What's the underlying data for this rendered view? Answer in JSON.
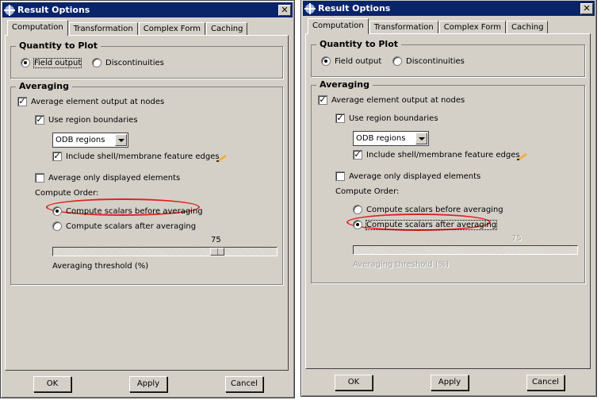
{
  "dialogs": [
    {
      "title": "Result Options",
      "tabs": [
        "Computation",
        "Transformation",
        "Complex Form",
        "Caching"
      ],
      "active_tab": "Computation",
      "quantity": {
        "title": "Quantity to Plot",
        "options": [
          "Field output",
          "Discontinuities"
        ],
        "selected": "Field output"
      },
      "averaging": {
        "title": "Averaging",
        "avg_nodes_label": "Average element output at nodes",
        "avg_nodes_checked": true,
        "region_label": "Use region boundaries",
        "region_checked": true,
        "region_combo": "ODB regions",
        "shell_label": "Include shell/membrane feature edges",
        "shell_checked": true,
        "displayed_label": "Average only displayed elements",
        "displayed_checked": false,
        "compute_order_label": "Compute Order:",
        "order_options": [
          "Compute scalars before averaging",
          "Compute scalars after averaging"
        ],
        "order_selected": "Compute scalars before averaging",
        "threshold_value": "75",
        "threshold_label": "Averaging threshold (%)",
        "threshold_enabled": true
      },
      "buttons": [
        "OK",
        "Apply",
        "Cancel"
      ]
    },
    {
      "title": "Result Options",
      "tabs": [
        "Computation",
        "Transformation",
        "Complex Form",
        "Caching"
      ],
      "active_tab": "Computation",
      "quantity": {
        "title": "Quantity to Plot",
        "options": [
          "Field output",
          "Discontinuities"
        ],
        "selected": "Field output"
      },
      "averaging": {
        "title": "Averaging",
        "avg_nodes_label": "Average element output at nodes",
        "avg_nodes_checked": true,
        "region_label": "Use region boundaries",
        "region_checked": true,
        "region_combo": "ODB regions",
        "shell_label": "Include shell/membrane feature edges",
        "shell_checked": true,
        "displayed_label": "Average only displayed elements",
        "displayed_checked": false,
        "compute_order_label": "Compute Order:",
        "order_options": [
          "Compute scalars before averaging",
          "Compute scalars after averaging"
        ],
        "order_selected": "Compute scalars after averaging",
        "threshold_value": "75",
        "threshold_label": "Averaging threshold (%)",
        "threshold_enabled": false
      },
      "buttons": [
        "OK",
        "Apply",
        "Cancel"
      ]
    }
  ],
  "annotation_color": "#e02020",
  "threshold_fraction": 0.75
}
